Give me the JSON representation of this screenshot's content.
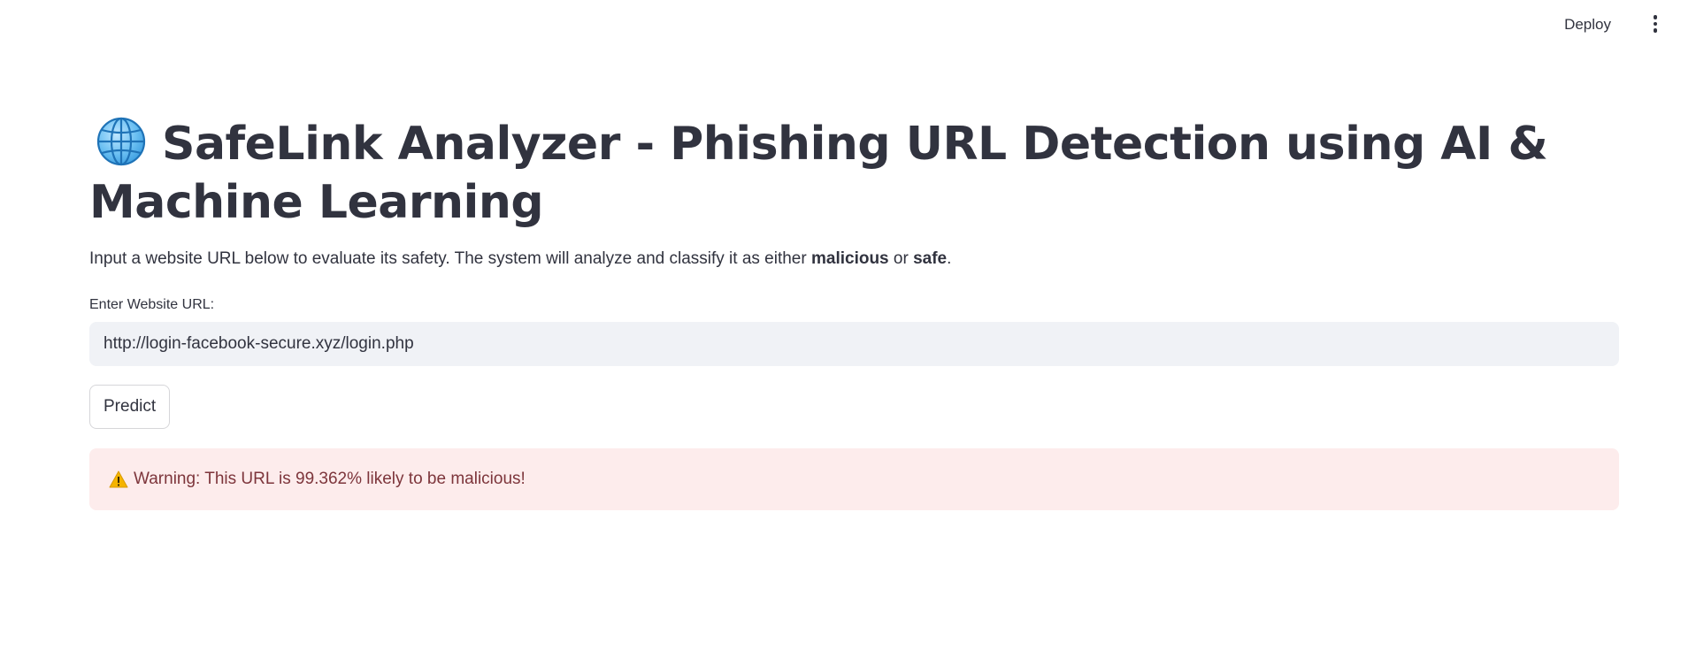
{
  "header": {
    "deploy_label": "Deploy",
    "menu_icon": "vertical-ellipsis-icon"
  },
  "main": {
    "title_icon": "globe-icon",
    "title": "SafeLink Analyzer - Phishing URL Detection using AI & Machine Learning",
    "description": {
      "prefix": "Input a website URL below to evaluate its safety. The system will analyze and classify it as either ",
      "bold1": "malicious",
      "middle": " or ",
      "bold2": "safe",
      "suffix": "."
    },
    "url_label": "Enter Website URL:",
    "url_value": "http://login-facebook-secure.xyz/login.php",
    "predict_label": "Predict",
    "alert": {
      "icon": "warning-icon",
      "text": "Warning: This URL is 99.362% likely to be malicious!"
    }
  },
  "colors": {
    "text": "#31333f",
    "input_bg": "#f0f2f6",
    "alert_bg": "#fdecec",
    "alert_text": "#7d353b"
  }
}
